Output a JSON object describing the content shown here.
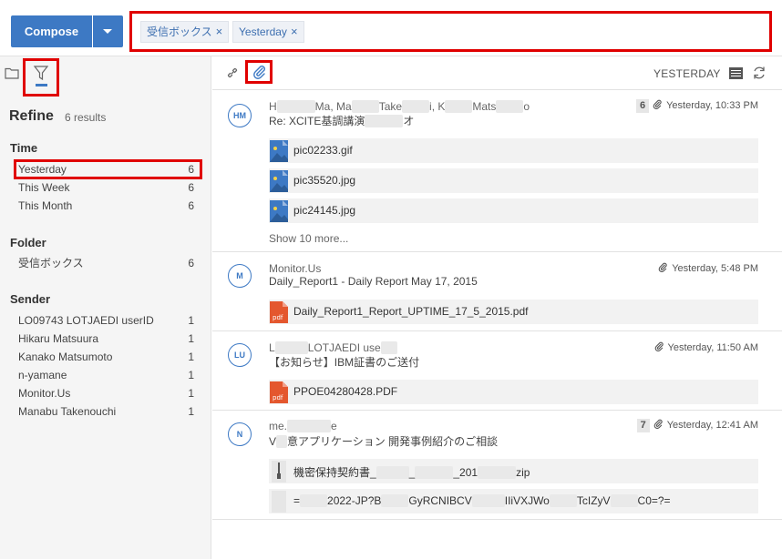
{
  "compose": {
    "label": "Compose"
  },
  "search": {
    "chips": [
      {
        "label": "受信ボックス",
        "remove": "×"
      },
      {
        "label": "Yesterday",
        "remove": "×"
      }
    ]
  },
  "refine": {
    "title": "Refine",
    "results": "6 results",
    "sections": {
      "time": {
        "heading": "Time",
        "items": [
          {
            "label": "Yesterday",
            "count": "6"
          },
          {
            "label": "This Week",
            "count": "6"
          },
          {
            "label": "This Month",
            "count": "6"
          }
        ]
      },
      "folder": {
        "heading": "Folder",
        "items": [
          {
            "label": "受信ボックス",
            "count": "6"
          }
        ]
      },
      "sender": {
        "heading": "Sender",
        "items": [
          {
            "label": "LO09743 LOTJAEDI userID",
            "count": "1"
          },
          {
            "label": "Hikaru Matsuura",
            "count": "1"
          },
          {
            "label": "Kanako Matsumoto",
            "count": "1"
          },
          {
            "label": "n-yamane",
            "count": "1"
          },
          {
            "label": "Monitor.Us",
            "count": "1"
          },
          {
            "label": "Manabu Takenouchi",
            "count": "1"
          }
        ]
      }
    }
  },
  "toolbar": {
    "sort_label": "YESTERDAY"
  },
  "mails": [
    {
      "avatar": "HM",
      "sender_parts": [
        "H",
        "M",
        "a, Ma",
        "Take",
        "i, K",
        "Mats",
        "o"
      ],
      "subject_parts": [
        "Re: XCITE基調講演",
        "オ"
      ],
      "count": "6",
      "time": "Yesterday, 10:33 PM",
      "attachments": [
        "pic02233.gif",
        "pic35520.jpg",
        "pic24145.jpg"
      ],
      "show_more": "Show 10 more..."
    },
    {
      "avatar": "M",
      "sender": "Monitor.Us",
      "subject": "Daily_Report1 - Daily Report May 17, 2015",
      "time": "Yesterday, 5:48 PM",
      "attachments": [
        "Daily_Report1_Report_UPTIME_17_5_2015.pdf"
      ],
      "file_type": "pdf"
    },
    {
      "avatar": "LU",
      "sender_parts": [
        "L",
        "LOTJAEDI use"
      ],
      "subject": "【お知らせ】IBM証書のご送付",
      "time": "Yesterday, 11:50 AM",
      "attachments": [
        "PPOE04280428.PDF"
      ],
      "file_type": "pdf"
    },
    {
      "avatar": "N",
      "sender_parts": [
        "me.",
        "e"
      ],
      "subject_parts": [
        "V",
        "意アプリケーション 開発事例紹介のご相談"
      ],
      "count": "7",
      "time": "Yesterday, 12:41 AM",
      "attachment_parts": [
        [
          "機密保持契約書_",
          "_",
          "_201",
          "zip"
        ],
        [
          "=",
          "2022-JP?B",
          "GyRCNIBCV",
          "IIiVXJWo",
          "TcIZyV",
          "C0=?="
        ]
      ]
    }
  ],
  "colors": {
    "accent": "#3d79c4",
    "highlight": "#e00000",
    "pdf": "#e4572e"
  }
}
